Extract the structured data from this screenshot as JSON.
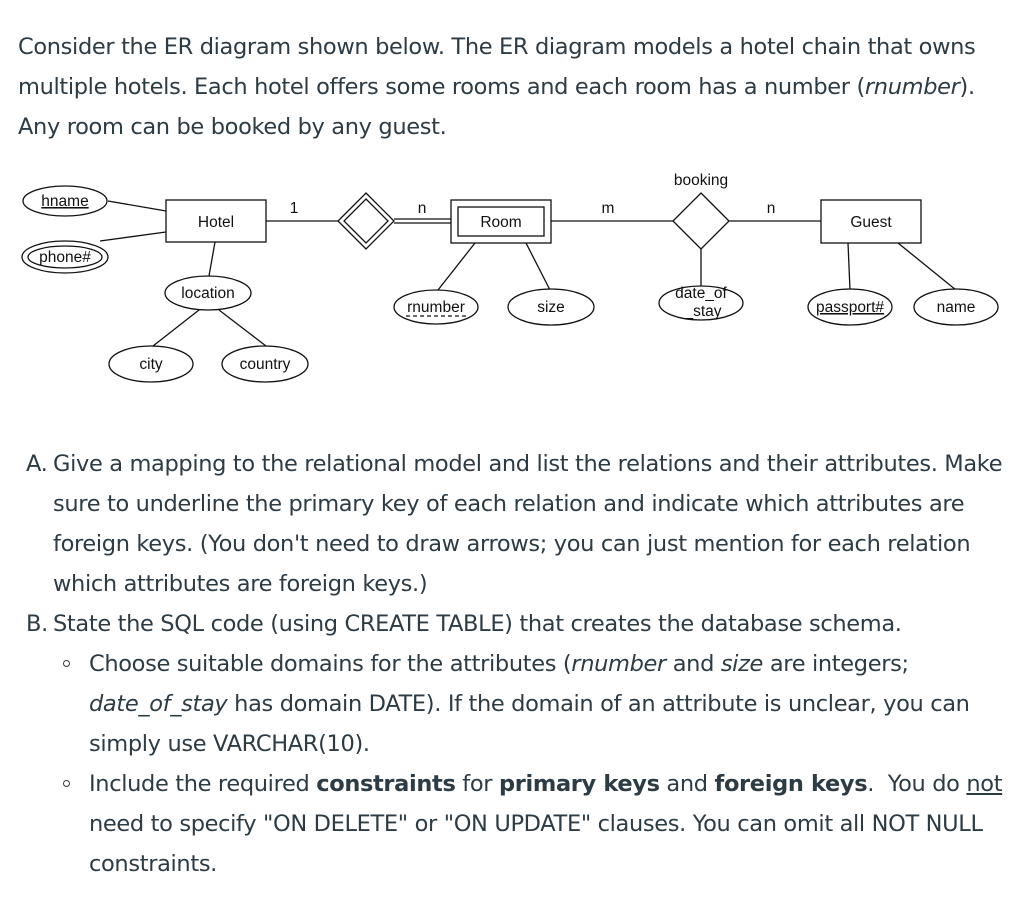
{
  "intro": {
    "p1": "Consider the ER diagram shown below. The ER diagram models a hotel chain that owns multiple hotels. Each hotel offers some rooms and each room has a number (",
    "p1_italic": "rnumber",
    "p2": "). Any room can be booked by any guest."
  },
  "diagram": {
    "entities": {
      "hotel": "Hotel",
      "room": "Room",
      "guest": "Guest"
    },
    "relationships": {
      "booking": "booking"
    },
    "attributes": {
      "hname": "hname",
      "phone": "phone#",
      "location": "location",
      "city": "city",
      "country": "country",
      "rnumber": "rnumber",
      "size": "size",
      "date_of_stay_line1": "date_of",
      "date_of_stay_line2": "_stay",
      "passport": "passport#",
      "name": "name"
    },
    "cardinalities": {
      "hotel_side": "1",
      "room_side_owns": "n",
      "room_side_booking": "m",
      "guest_side": "n"
    }
  },
  "tasks": {
    "a": {
      "marker": "A.",
      "text": "Give a mapping to the relational model and list the relations and their attributes. Make sure to underline the primary key of each relation and indicate which attributes are foreign keys. (You don't need to draw arrows; you can just mention for each relation which attributes are foreign keys.)"
    },
    "b": {
      "marker": "B.",
      "text": "State the SQL code (using CREATE TABLE) that creates the database schema.",
      "sub1": {
        "t1": "Choose suitable domains for the attributes (",
        "i1": "rnumber",
        "t2": " and ",
        "i2": "size",
        "t3": " are integers; ",
        "i3": "date_of_stay",
        "t4": " has domain DATE). If the domain of an attribute is unclear, you can simply use VARCHAR(10)."
      },
      "sub2": {
        "t1": "Include the required ",
        "b1": "constraints",
        "t2": " for ",
        "b2": "primary keys",
        "t3": " and ",
        "b3": "foreign keys",
        "t4": ".  You do ",
        "u1": "not",
        "t5": " need to specify \"ON DELETE\" or \"ON UPDATE\" clauses. You can omit all NOT NULL constraints."
      }
    }
  }
}
